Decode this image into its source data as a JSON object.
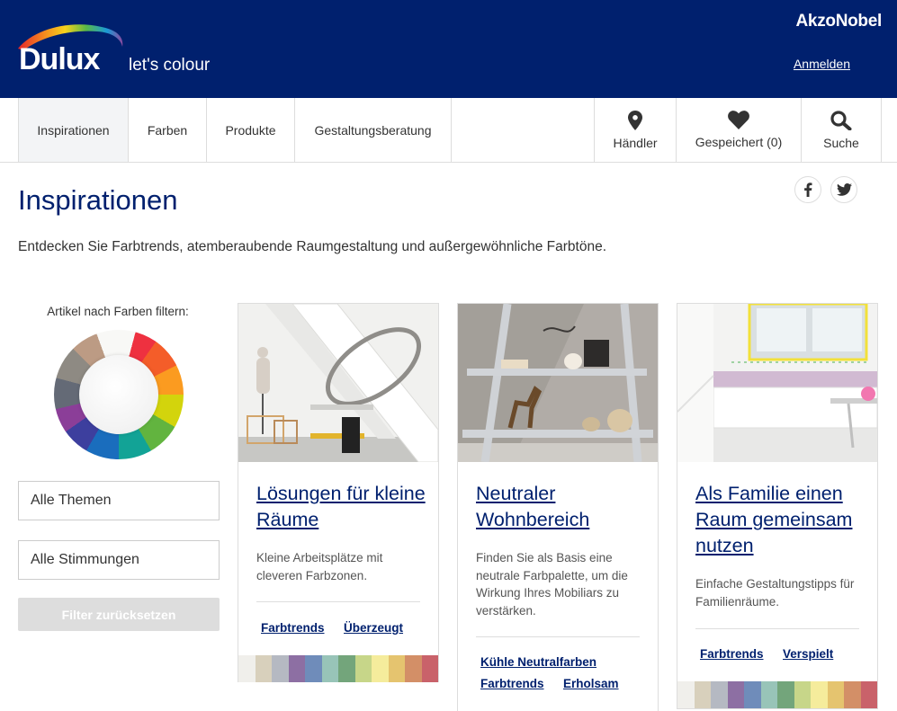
{
  "header": {
    "logo_word": "Dulux",
    "logo_tagline": "let's colour",
    "brand": "AkzoNobel",
    "login_label": "Anmelden",
    "background": "#00206e"
  },
  "nav": {
    "items": [
      {
        "label": "Inspirationen",
        "active": true
      },
      {
        "label": "Farben"
      },
      {
        "label": "Produkte"
      },
      {
        "label": "Gestaltungsberatung"
      }
    ],
    "tools": [
      {
        "label": "Händler",
        "icon": "location-pin-icon"
      },
      {
        "label": "Gespeichert (0)",
        "icon": "heart-icon"
      },
      {
        "label": "Suche",
        "icon": "search-icon"
      }
    ]
  },
  "page": {
    "title": "Inspirationen",
    "intro": "Entdecken Sie Farbtrends, atemberaubende Raumgestaltung und außergewöhnliche Farbtöne.",
    "social": [
      "facebook-icon",
      "twitter-icon"
    ]
  },
  "sidebar": {
    "filter_label": "Artikel nach Farben filtern:",
    "themes_label": "Alle Themen",
    "moods_label": "Alle Stimmungen",
    "reset_label": "Filter zurücksetzen"
  },
  "cards": [
    {
      "title": "Lösungen für kleine Räume",
      "description": "Kleine Arbeitsplätze mit cleveren Farbzonen.",
      "tags": [
        "Farbtrends",
        "Überzeugt"
      ]
    },
    {
      "title": "Neutraler Wohnbereich",
      "description": "Finden Sie als Basis eine neutrale Farbpalette, um die Wirkung Ihres Mobiliars zu verstärken.",
      "tags": [
        "Kühle Neutralfarben",
        "Farbtrends",
        "Erholsam"
      ]
    },
    {
      "title": "Als Familie einen Raum gemeinsam nutzen",
      "description": "Einfache Gestaltungstipps für Familienräume.",
      "tags": [
        "Farbtrends",
        "Verspielt"
      ]
    }
  ],
  "swatch_colors": [
    "#f0efeb",
    "#d8d0bc",
    "#b5b9c2",
    "#8d6fa3",
    "#6f8cba",
    "#98c4b8",
    "#73a57b",
    "#c7d689",
    "#f5ec9c",
    "#e5c46f",
    "#d38f67",
    "#c9626a"
  ]
}
